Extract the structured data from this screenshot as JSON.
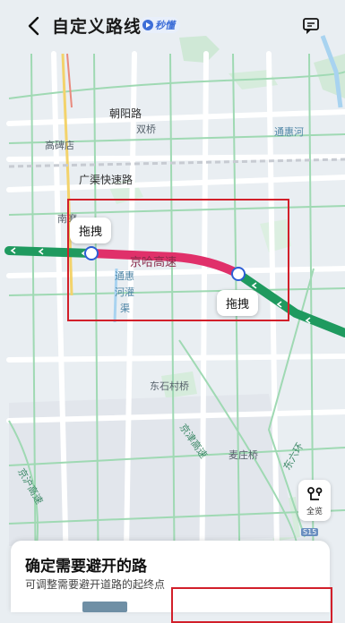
{
  "header": {
    "title": "自定义路线",
    "badge": "秒懂"
  },
  "map": {
    "labels": {
      "chaoyang_road": "朝阳路",
      "shuangqiao": "双桥",
      "tonghui_river": "通惠河",
      "gaobeidian": "高碑店",
      "guangqu_expressway": "广渠快速路",
      "nanmofang": "南磨",
      "route_road_name": "京哈高速",
      "tonghui_canal_1": "通惠",
      "tonghui_canal_2": "河灌",
      "tonghui_canal_3": "渠",
      "dongshicun_bridge": "东石村桥",
      "jingjin_expressway": "京津高速",
      "maozhuang_bridge": "麦庄桥",
      "east_sixth_ring": "东六环",
      "jinghu_expressway": "京沪高速",
      "s15": "S15"
    },
    "drag_label": "拖拽",
    "overview_label": "全览"
  },
  "panel": {
    "title": "确定需要避开的路",
    "subtitle": "可调整需要避开道路的起终点"
  },
  "colors": {
    "route_green": "#1f9a5f",
    "route_avoid": "#e0306a",
    "annotation_red": "#d21f2a",
    "accent_blue": "#3d6ed8"
  }
}
